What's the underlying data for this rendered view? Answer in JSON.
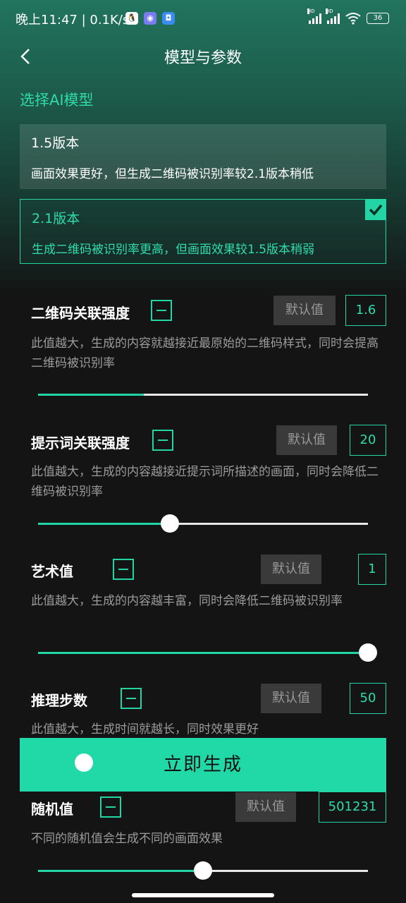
{
  "status_bar": {
    "time": "晚上11:47 | 0.1K/s",
    "battery": "36"
  },
  "header": {
    "title": "模型与参数"
  },
  "model_section": {
    "label": "选择AI模型",
    "models": [
      {
        "name": "1.5版本",
        "desc": "画面效果更好，但生成二维码被识别率较2.1版本稍低",
        "selected": false
      },
      {
        "name": "2.1版本",
        "desc": "生成二维码被识别率更高，但画面效果较1.5版本稍弱",
        "selected": true
      }
    ]
  },
  "params": [
    {
      "title": "二维码关联强度",
      "default_label": "默认值",
      "value": "1.6",
      "desc": "此值越大，生成的内容就越接近最原始的二维码样式，同时会提高二维码被识别率",
      "slider_fraction": 0.32,
      "thumb_visible": false
    },
    {
      "title": "提示词关联强度",
      "default_label": "默认值",
      "value": "20",
      "desc": "此值越大，生成的内容越接近提示词所描述的画面，同时会降低二维码被识别率",
      "slider_fraction": 0.4,
      "thumb_visible": true
    },
    {
      "title": "艺术值",
      "default_label": "默认值",
      "value": "1",
      "desc": "此值越大，生成的内容越丰富，同时会降低二维码被识别率",
      "slider_fraction": 1.0,
      "thumb_visible": true
    },
    {
      "title": "推理步数",
      "default_label": "默认值",
      "value": "50",
      "desc": "此值越大，生成时间就越长，同时效果更好",
      "slider_fraction": null,
      "thumb_visible": false
    },
    {
      "title": "随机值",
      "default_label": "默认值",
      "value": "501231",
      "desc": "不同的随机值会生成不同的画面效果",
      "slider_fraction": 0.5,
      "thumb_visible": true
    }
  ],
  "generate_button": {
    "label": "立即生成"
  },
  "colors": {
    "accent": "#23d4a4",
    "background": "#141414",
    "header_gradient": "#21745e"
  }
}
